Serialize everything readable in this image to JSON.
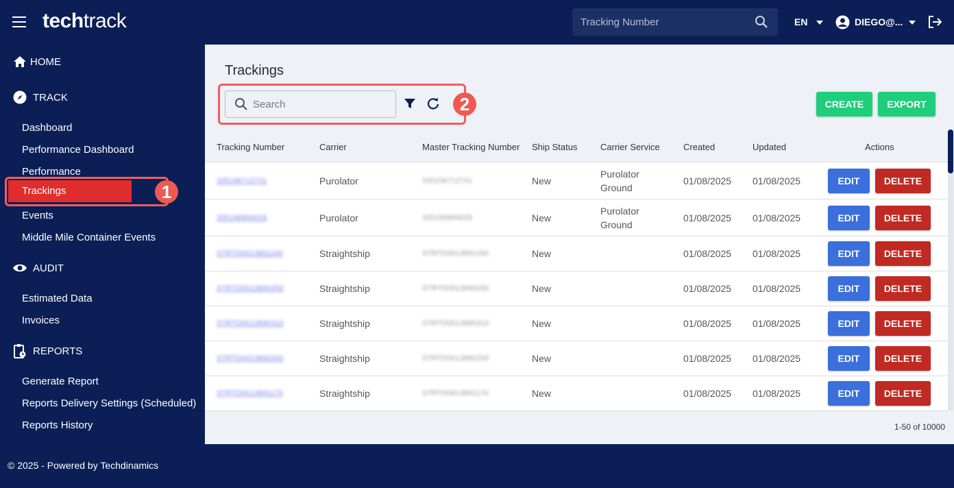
{
  "header": {
    "logo_bold": "tech",
    "logo_light": "track",
    "tracking_placeholder": "Tracking Number",
    "language": "EN",
    "user": "DIEGO@..."
  },
  "sidebar": {
    "home": "HOME",
    "track": "TRACK",
    "track_items": [
      "Dashboard",
      "Performance Dashboard",
      "Performance",
      "Trackings",
      "Events",
      "Middle Mile Container Events"
    ],
    "audit": "AUDIT",
    "audit_items": [
      "Estimated Data",
      "Invoices"
    ],
    "reports": "REPORTS",
    "reports_items": [
      "Generate Report",
      "Reports Delivery Settings (Scheduled)",
      "Reports History"
    ]
  },
  "annotations": {
    "badge1": "1",
    "badge2": "2"
  },
  "main": {
    "title": "Trackings",
    "search_placeholder": "Search",
    "create_label": "CREATE",
    "export_label": "EXPORT",
    "columns": [
      "Tracking Number",
      "Carrier",
      "Master Tracking Number",
      "Ship Status",
      "Carrier Service",
      "Created",
      "Updated",
      "Actions"
    ],
    "edit_label": "EDIT",
    "delete_label": "DELETE",
    "rows": [
      {
        "tracking": "335196712741",
        "carrier": "Purolator",
        "master": "335196712741",
        "status": "New",
        "service_1": "Purolator",
        "service_2": "Ground",
        "created": "01/08/2025",
        "updated": "01/08/2025"
      },
      {
        "tracking": "335196894026",
        "carrier": "Purolator",
        "master": "335196894026",
        "status": "New",
        "service_1": "Purolator",
        "service_2": "Ground",
        "created": "01/08/2025",
        "updated": "01/08/2025"
      },
      {
        "tracking": "STRTD0013891160",
        "carrier": "Straightship",
        "master": "STRTD0013891160",
        "status": "New",
        "service_1": "",
        "service_2": "",
        "created": "01/08/2025",
        "updated": "01/08/2025"
      },
      {
        "tracking": "STRTD0013890250",
        "carrier": "Straightship",
        "master": "STRTD0013890250",
        "status": "New",
        "service_1": "",
        "service_2": "",
        "created": "01/08/2025",
        "updated": "01/08/2025"
      },
      {
        "tracking": "STRTD0013890310",
        "carrier": "Straightship",
        "master": "STRTD0013890310",
        "status": "New",
        "service_1": "",
        "service_2": "",
        "created": "01/08/2025",
        "updated": "01/08/2025"
      },
      {
        "tracking": "STRTD0013890200",
        "carrier": "Straightship",
        "master": "STRTD0013890200",
        "status": "New",
        "service_1": "",
        "service_2": "",
        "created": "01/08/2025",
        "updated": "01/08/2025"
      },
      {
        "tracking": "STRTD0013891170",
        "carrier": "Straightship",
        "master": "STRTD0013891170",
        "status": "New",
        "service_1": "",
        "service_2": "",
        "created": "01/08/2025",
        "updated": "01/08/2025"
      }
    ],
    "pagination": "1-50 of 10000"
  },
  "footer": {
    "text": "© 2025 - Powered by Techdinamics"
  },
  "colors": {
    "navy": "#0b1f56",
    "green": "#1fce7a",
    "edit_blue": "#3b6fdc",
    "delete_red": "#c02a22",
    "highlight": "#e02d2d"
  }
}
